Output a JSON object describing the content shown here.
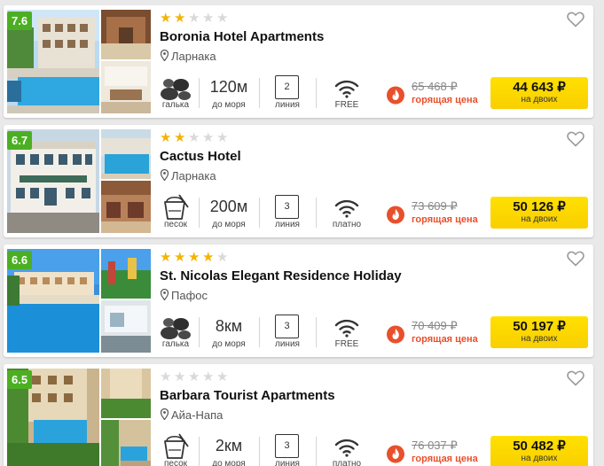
{
  "colors": {
    "rating_bg": "#4caf23",
    "star_on": "#f5b400",
    "star_off": "#d9d9d9",
    "hot": "#e8502c",
    "price_button": "#ffe000"
  },
  "hotels": [
    {
      "rating": "7.6",
      "stars": 2,
      "name": "Boronia Hotel Apartments",
      "location": "Ларнака",
      "beach": "галька",
      "beach_icon": "pebbles-icon",
      "distance": "120м",
      "distance_label": "до моря",
      "line": "2",
      "line_label": "линия",
      "wifi": "FREE",
      "wifi_icon": "wifi-icon",
      "old_price": "65 468 ₽",
      "hot_label": "горящая цена",
      "price": "44 643 ₽",
      "price_sub": "на двоих"
    },
    {
      "rating": "6.7",
      "stars": 2,
      "name": "Cactus Hotel",
      "location": "Ларнака",
      "beach": "песок",
      "beach_icon": "sand-bucket-icon",
      "distance": "200м",
      "distance_label": "до моря",
      "line": "3",
      "line_label": "линия",
      "wifi": "платно",
      "wifi_icon": "wifi-icon",
      "old_price": "73 609 ₽",
      "hot_label": "горящая цена",
      "price": "50 126 ₽",
      "price_sub": "на двоих"
    },
    {
      "rating": "6.6",
      "stars": 4,
      "name": "St. Nicolas Elegant Residence Holiday",
      "location": "Пафос",
      "beach": "галька",
      "beach_icon": "pebbles-icon",
      "distance": "8км",
      "distance_label": "до моря",
      "line": "3",
      "line_label": "линия",
      "wifi": "FREE",
      "wifi_icon": "wifi-icon",
      "old_price": "70 409 ₽",
      "hot_label": "горящая цена",
      "price": "50 197 ₽",
      "price_sub": "на двоих"
    },
    {
      "rating": "6.5",
      "stars": 0,
      "name": "Barbara Tourist Apartments",
      "location": "Айа-Напа",
      "beach": "песок",
      "beach_icon": "sand-bucket-icon",
      "distance": "2км",
      "distance_label": "до моря",
      "line": "3",
      "line_label": "линия",
      "wifi": "платно",
      "wifi_icon": "wifi-icon",
      "old_price": "76 037 ₽",
      "hot_label": "горящая цена",
      "price": "50 482 ₽",
      "price_sub": "на двоих"
    }
  ]
}
